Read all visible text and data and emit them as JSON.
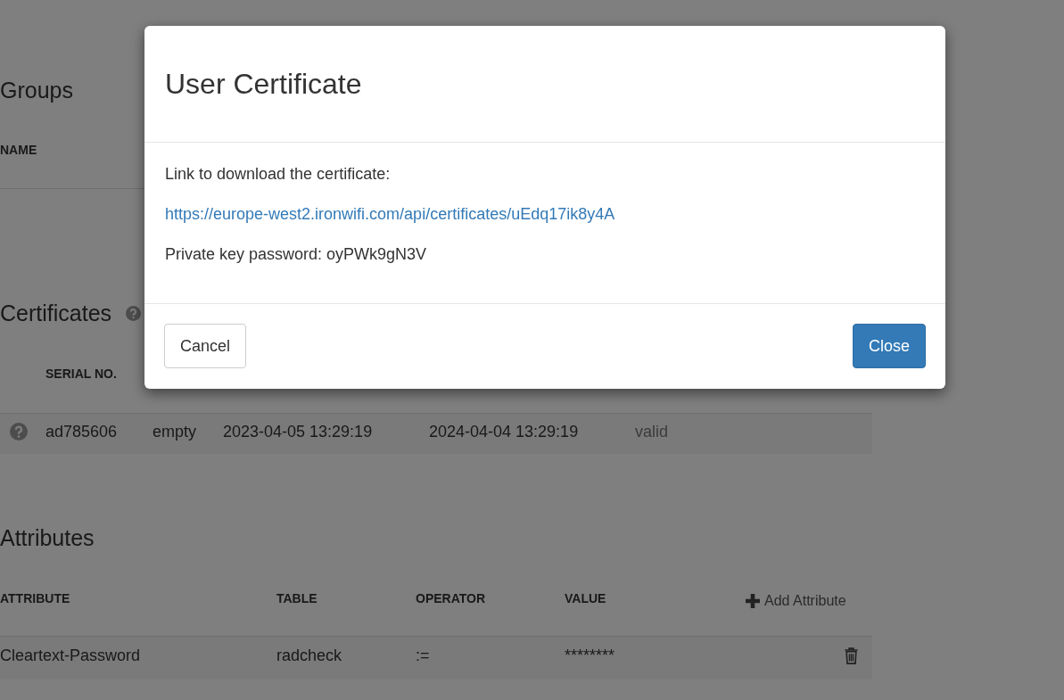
{
  "groups": {
    "title": "Groups",
    "columns": [
      "NAME"
    ]
  },
  "certificates": {
    "title": "Certificates",
    "columns": [
      "SERIAL NO."
    ],
    "rows": [
      {
        "cells": [
          "ad785606",
          "empty",
          "2023-04-05 13:29:19",
          "2024-04-04 13:29:19",
          "valid"
        ]
      }
    ]
  },
  "attributes": {
    "title": "Attributes",
    "columns": [
      "ATTRIBUTE",
      "TABLE",
      "OPERATOR",
      "VALUE"
    ],
    "add_label": "Add Attribute",
    "rows": [
      {
        "cells": [
          "Cleartext-Password",
          "radcheck",
          ":=",
          "********"
        ]
      }
    ]
  },
  "modal": {
    "title": "User Certificate",
    "intro": "Link to download the certificate:",
    "link": "https://europe-west2.ironwifi.com/api/certificates/uEdq17ik8y4A",
    "password_line": "Private key password: oyPWk9gN3V",
    "buttons": [
      {
        "label": "Cancel",
        "kind": "default"
      },
      {
        "label": "Close",
        "kind": "primary"
      }
    ]
  }
}
